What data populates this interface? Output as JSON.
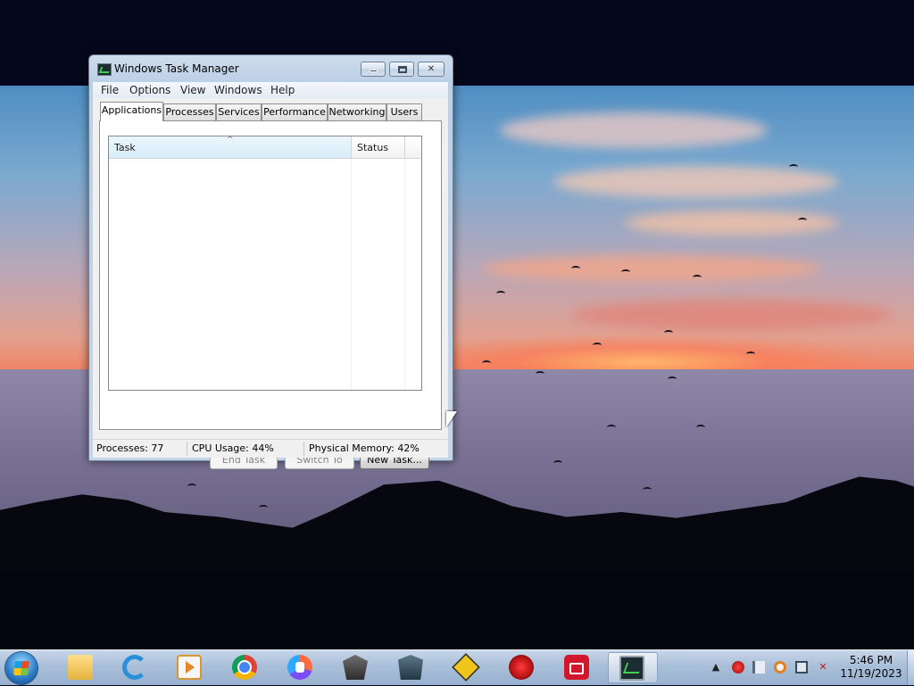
{
  "window": {
    "title": "Windows Task Manager",
    "menu": [
      "File",
      "Options",
      "View",
      "Windows",
      "Help"
    ],
    "tabs": [
      "Applications",
      "Processes",
      "Services",
      "Performance",
      "Networking",
      "Users"
    ],
    "selected_tab": "Applications",
    "columns": {
      "task": "Task",
      "status": "Status"
    },
    "buttons": {
      "end_task": "End Task",
      "switch_to": "Switch To",
      "new_task": "New Task..."
    },
    "status": {
      "processes": "Processes: 77",
      "cpu": "CPU Usage: 44%",
      "memory": "Physical Memory: 42%"
    }
  },
  "taskbar": {
    "pinned_icons": [
      "explorer-icon",
      "ie-icon",
      "media-icon",
      "chrome-icon",
      "vpn-icon",
      "tanks-icon",
      "warships-icon",
      "game3-icon",
      "redapp-icon",
      "recorder-icon",
      "taskmgr-tb-icon"
    ],
    "active_app": "taskmgr-tb-icon",
    "tray_icons": [
      "show-hidden-icon",
      "red-alert-icon",
      "action-center-flag-icon",
      "security-icon",
      "network-icon",
      "volume-muted-icon"
    ],
    "clock": {
      "time": "5:46 PM",
      "date": "11/19/2023"
    }
  },
  "colors": {
    "taskbar": "#a9bfd9",
    "window_frame": "#bcd0e6",
    "selected_column": "#d8edf9"
  }
}
